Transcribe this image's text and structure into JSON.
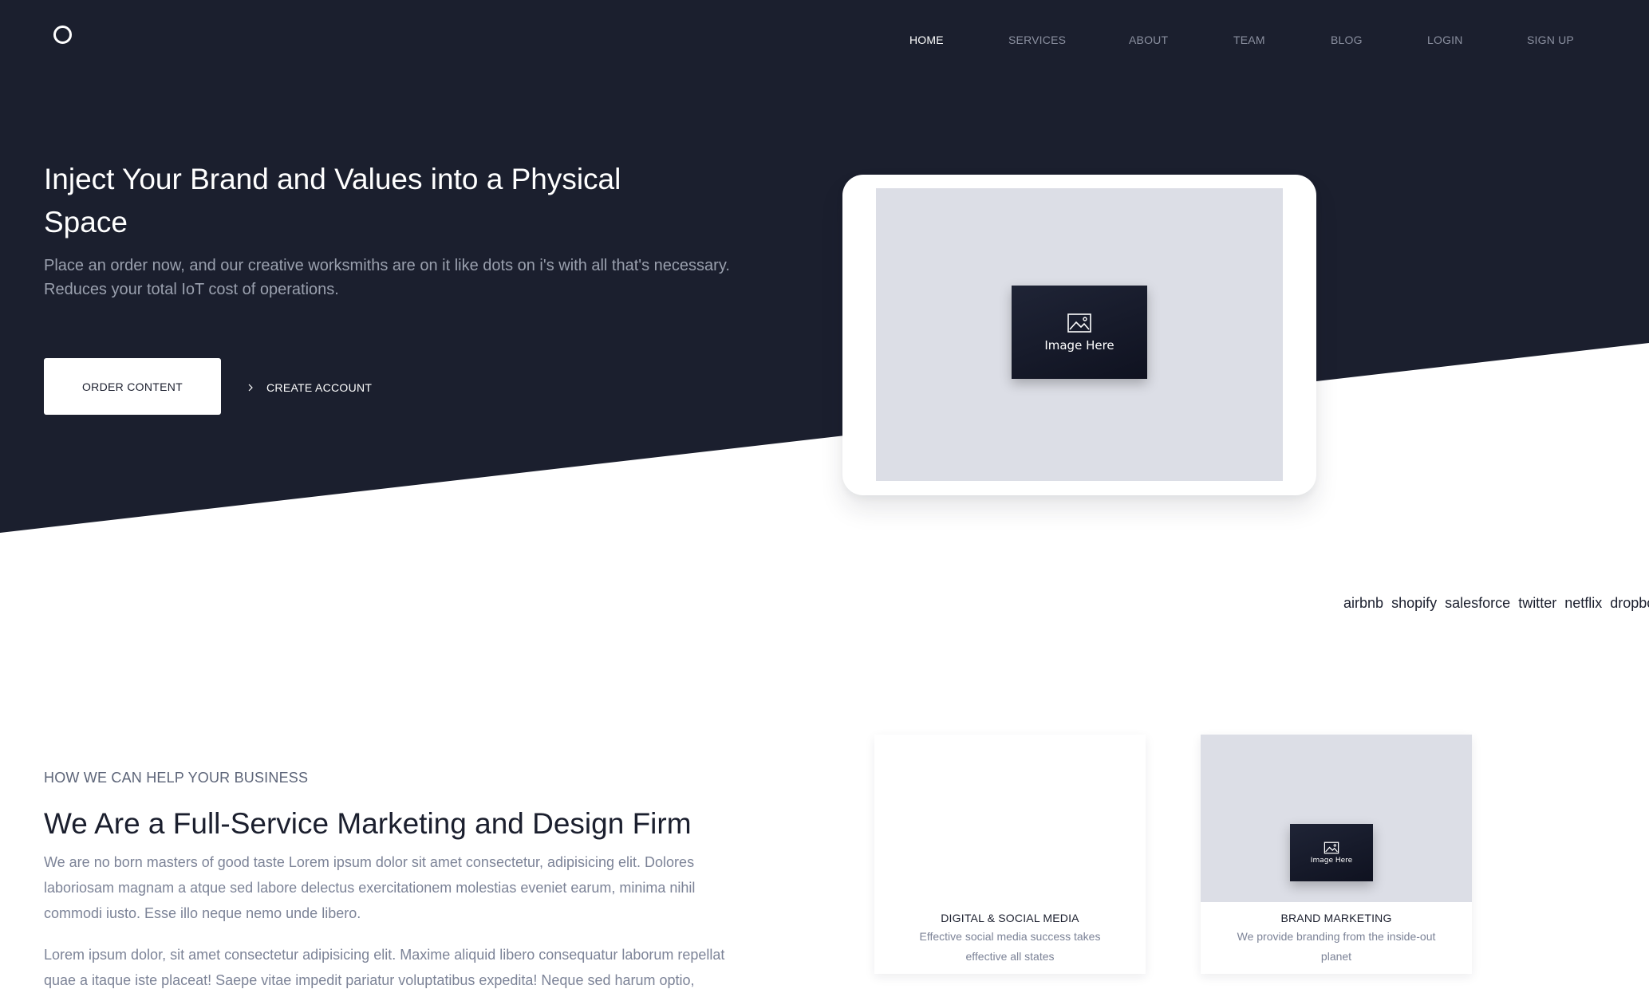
{
  "nav": {
    "items": [
      "HOME",
      "SERVICES",
      "ABOUT",
      "TEAM",
      "BLOG",
      "LOGIN",
      "SIGN UP"
    ]
  },
  "hero": {
    "title": "Inject Your Brand and Values into a Physical Space",
    "subtitle": "Place an order now, and our creative worksmiths are on it like dots on i's with all that's necessary. Reduces your total IoT cost of operations.",
    "order_button": "ORDER CONTENT",
    "create_account": "CREATE ACCOUNT",
    "image_label": "Image Here"
  },
  "brands": [
    "airbnb",
    "shopify",
    "salesforce",
    "twitter",
    "netflix",
    "dropbox"
  ],
  "section": {
    "kicker": "HOW WE CAN HELP YOUR BUSINESS",
    "title": "We Are a Full-Service Marketing and Design Firm",
    "paragraph1": "We are no born masters of good taste Lorem ipsum dolor sit amet consectetur, adipisicing elit. Dolores laboriosam magnam a atque sed labore delectus exercitationem molestias eveniet earum, minima nihil commodi iusto. Esse illo neque nemo unde libero.",
    "paragraph2": "Lorem ipsum dolor, sit amet consectetur adipisicing elit. Maxime aliquid libero consequatur laborum repellat quae a itaque iste placeat! Saepe vitae impedit pariatur voluptatibus expedita! Neque sed harum optio,"
  },
  "cards": [
    {
      "title": "DIGITAL & SOCIAL MEDIA",
      "description": "Effective social media success takes effective all states"
    },
    {
      "title": "BRAND MARKETING",
      "description": "We provide branding from the inside-out planet",
      "image_label": "Image Here"
    }
  ],
  "colors": {
    "dark_navy": "#1b1f2e",
    "placeholder_gray": "#dcdee6",
    "muted_text": "#7c8397",
    "white": "#ffffff"
  },
  "icons": [
    "logo-circle-icon",
    "chevron-right-icon",
    "image-icon"
  ]
}
